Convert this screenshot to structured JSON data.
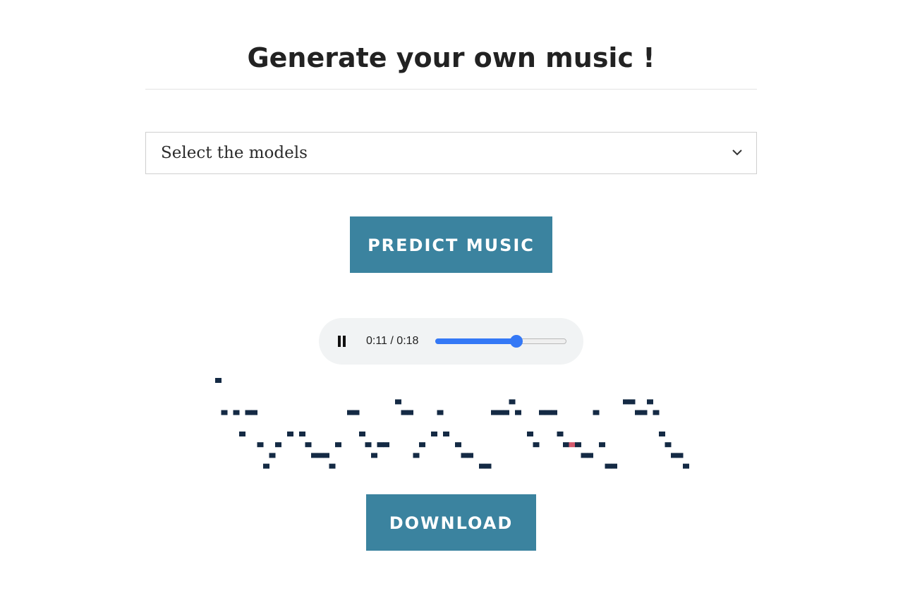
{
  "header": {
    "title": "Generate your own music !"
  },
  "model_select": {
    "placeholder": "Select the models",
    "icon": "chevron-down-icon"
  },
  "buttons": {
    "predict_label": "PREDICT MUSIC",
    "download_label": "DOWNLOAD"
  },
  "audio": {
    "time_display": "0:11 / 0:18",
    "progress": 0.611,
    "state": "playing",
    "pause_icon": "pause-icon"
  },
  "colors": {
    "button_bg": "#3b839f",
    "note_color": "#142a44",
    "playhead_note_color": "#d45a6d",
    "seek_accent": "#3478f6"
  },
  "piano_roll": {
    "active_note_index": 50,
    "notes": [
      {
        "step": 0,
        "pitch": 0
      },
      {
        "step": 0.5,
        "pitch": -3
      },
      {
        "step": 1.5,
        "pitch": -3
      },
      {
        "step": 2.5,
        "pitch": -3
      },
      {
        "step": 3,
        "pitch": -3
      },
      {
        "step": 2,
        "pitch": -5
      },
      {
        "step": 3.5,
        "pitch": -6
      },
      {
        "step": 4,
        "pitch": -8
      },
      {
        "step": 4.5,
        "pitch": -7
      },
      {
        "step": 5,
        "pitch": -6
      },
      {
        "step": 6,
        "pitch": -5
      },
      {
        "step": 7,
        "pitch": -5
      },
      {
        "step": 7.5,
        "pitch": -6
      },
      {
        "step": 8,
        "pitch": -7
      },
      {
        "step": 8.5,
        "pitch": -7
      },
      {
        "step": 9,
        "pitch": -7
      },
      {
        "step": 9.5,
        "pitch": -8
      },
      {
        "step": 10,
        "pitch": -6
      },
      {
        "step": 11,
        "pitch": -3
      },
      {
        "step": 11.5,
        "pitch": -3
      },
      {
        "step": 12,
        "pitch": -5
      },
      {
        "step": 12.5,
        "pitch": -6
      },
      {
        "step": 13,
        "pitch": -7
      },
      {
        "step": 13.5,
        "pitch": -6
      },
      {
        "step": 14,
        "pitch": -6
      },
      {
        "step": 15,
        "pitch": -2
      },
      {
        "step": 15.5,
        "pitch": -3
      },
      {
        "step": 16,
        "pitch": -3
      },
      {
        "step": 16.5,
        "pitch": -7
      },
      {
        "step": 17,
        "pitch": -6
      },
      {
        "step": 18,
        "pitch": -5
      },
      {
        "step": 18.5,
        "pitch": -3
      },
      {
        "step": 19,
        "pitch": -5
      },
      {
        "step": 20,
        "pitch": -6
      },
      {
        "step": 20.5,
        "pitch": -7
      },
      {
        "step": 21,
        "pitch": -7
      },
      {
        "step": 22,
        "pitch": -8
      },
      {
        "step": 22.5,
        "pitch": -8
      },
      {
        "step": 23,
        "pitch": -3
      },
      {
        "step": 23.5,
        "pitch": -3
      },
      {
        "step": 24,
        "pitch": -3
      },
      {
        "step": 24.5,
        "pitch": -2
      },
      {
        "step": 25,
        "pitch": -3
      },
      {
        "step": 26,
        "pitch": -5
      },
      {
        "step": 26.5,
        "pitch": -6
      },
      {
        "step": 27,
        "pitch": -3
      },
      {
        "step": 27.5,
        "pitch": -3
      },
      {
        "step": 28,
        "pitch": -3
      },
      {
        "step": 28.5,
        "pitch": -5
      },
      {
        "step": 29,
        "pitch": -6
      },
      {
        "step": 29.5,
        "pitch": -6
      },
      {
        "step": 30,
        "pitch": -6
      },
      {
        "step": 30.5,
        "pitch": -7
      },
      {
        "step": 31,
        "pitch": -7
      },
      {
        "step": 31.5,
        "pitch": -3
      },
      {
        "step": 32,
        "pitch": -6
      },
      {
        "step": 32.5,
        "pitch": -8
      },
      {
        "step": 33,
        "pitch": -8
      },
      {
        "step": 34,
        "pitch": -2
      },
      {
        "step": 34.5,
        "pitch": -2
      },
      {
        "step": 35,
        "pitch": -3
      },
      {
        "step": 35.5,
        "pitch": -3
      },
      {
        "step": 36,
        "pitch": -2
      },
      {
        "step": 36.5,
        "pitch": -3
      },
      {
        "step": 37,
        "pitch": -5
      },
      {
        "step": 37.5,
        "pitch": -6
      },
      {
        "step": 38,
        "pitch": -7
      },
      {
        "step": 38.5,
        "pitch": -7
      },
      {
        "step": 39,
        "pitch": -8
      }
    ]
  }
}
